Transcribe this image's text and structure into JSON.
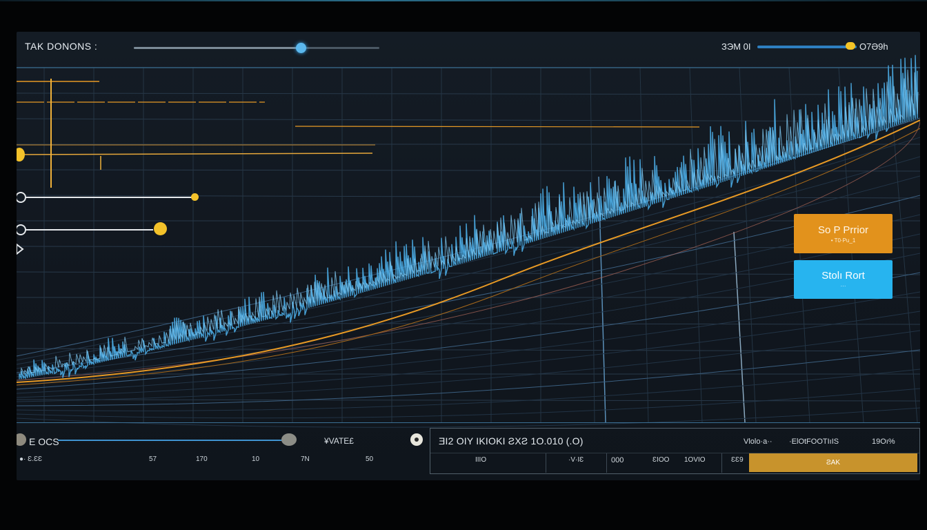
{
  "app": {
    "title": "TAK DONONS :",
    "top_slider_value": 0.68
  },
  "top_right": {
    "left_label": "ЗЭM 0I",
    "value_label": "O7Ə9h",
    "slider_value": 0.9
  },
  "actions": {
    "primary": {
      "label": "So P Prrior",
      "sub": "• T0·Pu_1"
    },
    "secondary": {
      "label": "Stolı Rort",
      "sub": "···"
    }
  },
  "bottom_bar": {
    "slider_label": "E OCS",
    "slider_value": 0.97,
    "mid_text": "¥VATE£",
    "tick_labels": [
      "●· Ɛ.ƐƐ",
      "57",
      "170",
      "10",
      "7N",
      "50"
    ]
  },
  "data_table": {
    "header": "ƎI2 OIY IKIOKI ƧXƧ 1O.010 (.O)",
    "right_headers": [
      "Vlolo·a··",
      "·ElOtFOOTIıIS",
      "19Oı%"
    ],
    "cells": [
      "IIIO",
      "·V·IƐ",
      "000",
      "ƐIOO",
      "1OVIO",
      "ƐƐ9"
    ],
    "action_label": "ƧAK"
  },
  "colors": {
    "accent_blue": "#5bb8ee",
    "accent_orange": "#e2921c",
    "accent_yellow": "#f4c22a",
    "cyan_button": "#27b4ef",
    "panel_bg": "#141c25"
  },
  "icons": {
    "side_marker": "play-triangle-icon",
    "bottom_left": "dial-icon",
    "bottom_thumb": "slider-knob-icon",
    "bottom_radio": "radio-icon"
  }
}
